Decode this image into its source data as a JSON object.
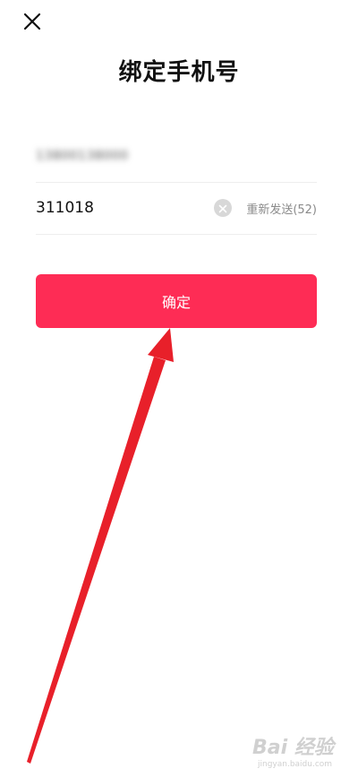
{
  "header": {
    "close_icon": "close-icon",
    "title": "绑定手机号"
  },
  "form": {
    "phone_value_blurred": "13800138000",
    "code_value": "311018",
    "clear_icon": "clear-icon",
    "resend_label": "重新发送(52)"
  },
  "actions": {
    "confirm_label": "确定",
    "confirm_color": "#fe2c55"
  },
  "annotation": {
    "arrow_color": "#e8202a"
  },
  "watermark": {
    "logo_text": "Bai 经验",
    "sub_text": "jingyan.baidu.com"
  }
}
